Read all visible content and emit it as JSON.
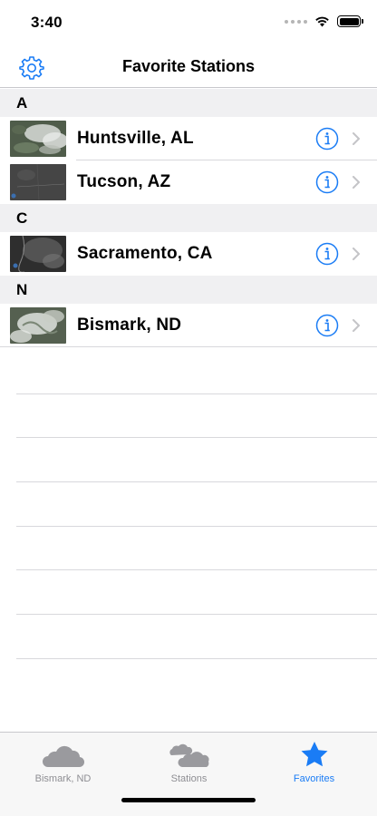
{
  "status_bar": {
    "time": "3:40"
  },
  "nav": {
    "title": "Favorite Stations",
    "settings_icon": "gear-icon"
  },
  "sections": [
    {
      "header": "A",
      "rows": [
        {
          "name": "Huntsville, AL",
          "thumb": "satellite-thumbnail"
        },
        {
          "name": "Tucson, AZ",
          "thumb": "satellite-thumbnail"
        }
      ]
    },
    {
      "header": "C",
      "rows": [
        {
          "name": "Sacramento, CA",
          "thumb": "satellite-thumbnail"
        }
      ]
    },
    {
      "header": "N",
      "rows": [
        {
          "name": "Bismark, ND",
          "thumb": "satellite-thumbnail"
        }
      ]
    }
  ],
  "tabs": [
    {
      "label": "Bismark, ND",
      "icon": "cloud-icon",
      "active": false
    },
    {
      "label": "Stations",
      "icon": "clouds-icon",
      "active": false
    },
    {
      "label": "Favorites",
      "icon": "star-icon",
      "active": true
    }
  ],
  "colors": {
    "accent": "#1a7cf5",
    "inactive_tab": "#8e8e93",
    "section_bg": "#f0f0f2"
  }
}
